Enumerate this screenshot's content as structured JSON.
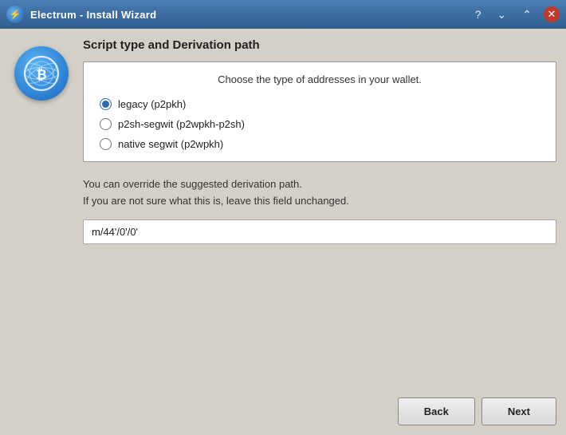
{
  "titlebar": {
    "title": "Electrum - Install Wizard",
    "icon": "⚡",
    "help_symbol": "?",
    "minimize_symbol": "⌄",
    "maximize_symbol": "⌃",
    "close_symbol": "✕"
  },
  "content": {
    "section_title": "Script type and Derivation path",
    "address_subtitle": "Choose the type of addresses in your wallet.",
    "radio_options": [
      {
        "id": "legacy",
        "label": "legacy (p2pkh)",
        "checked": true
      },
      {
        "id": "p2sh",
        "label": "p2sh-segwit (p2wpkh-p2sh)",
        "checked": false
      },
      {
        "id": "native",
        "label": "native segwit (p2wpkh)",
        "checked": false
      }
    ],
    "hint_line1": "You can override the suggested derivation path.",
    "hint_line2": "If you are not sure what this is, leave this field unchanged.",
    "derivation_value": "m/44'/0'/0'",
    "back_label": "Back",
    "next_label": "Next"
  }
}
